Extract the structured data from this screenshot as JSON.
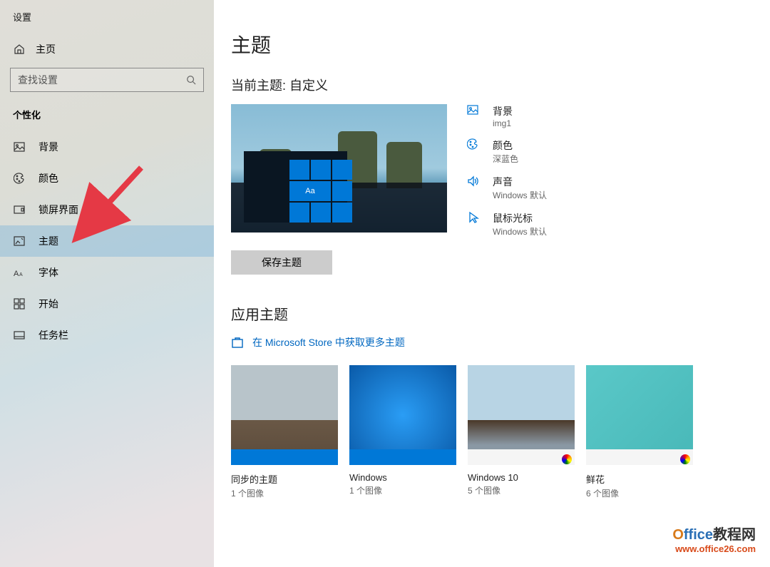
{
  "window_title": "设置",
  "home_label": "主页",
  "search_placeholder": "查找设置",
  "section": "个性化",
  "nav": [
    {
      "icon": "image",
      "label": "背景"
    },
    {
      "icon": "palette",
      "label": "颜色"
    },
    {
      "icon": "lock",
      "label": "锁屏界面"
    },
    {
      "icon": "theme",
      "label": "主题",
      "selected": true
    },
    {
      "icon": "font",
      "label": "字体"
    },
    {
      "icon": "start",
      "label": "开始"
    },
    {
      "icon": "taskbar",
      "label": "任务栏"
    }
  ],
  "main": {
    "title": "主题",
    "current_label": "当前主题: 自定义",
    "preview_tile_text": "Aa",
    "settings": [
      {
        "icon": "image",
        "label": "背景",
        "value": "img1"
      },
      {
        "icon": "palette",
        "label": "颜色",
        "value": "深蓝色"
      },
      {
        "icon": "sound",
        "label": "声音",
        "value": "Windows 默认"
      },
      {
        "icon": "cursor",
        "label": "鼠标光标",
        "value": "Windows 默认"
      }
    ],
    "save_button": "保存主题",
    "apply_title": "应用主题",
    "store_link": "在 Microsoft Store 中获取更多主题",
    "themes": [
      {
        "name": "同步的主题",
        "count": "1 个图像",
        "bar": "#0078d7",
        "bg": "dog"
      },
      {
        "name": "Windows",
        "count": "1 个图像",
        "bar": "#0078d7",
        "bg": "winblue"
      },
      {
        "name": "Windows 10",
        "count": "5 个图像",
        "bar": "#f5f5f5",
        "bg": "beach",
        "badge": true
      },
      {
        "name": "鲜花",
        "count": "6 个图像",
        "bar": "#f5f5f5",
        "bg": "flower",
        "badge": true
      }
    ]
  },
  "watermark": {
    "line1a": "O",
    "line1b": "ffice",
    "line1c": "教程网",
    "line2": "www.office26.com"
  }
}
